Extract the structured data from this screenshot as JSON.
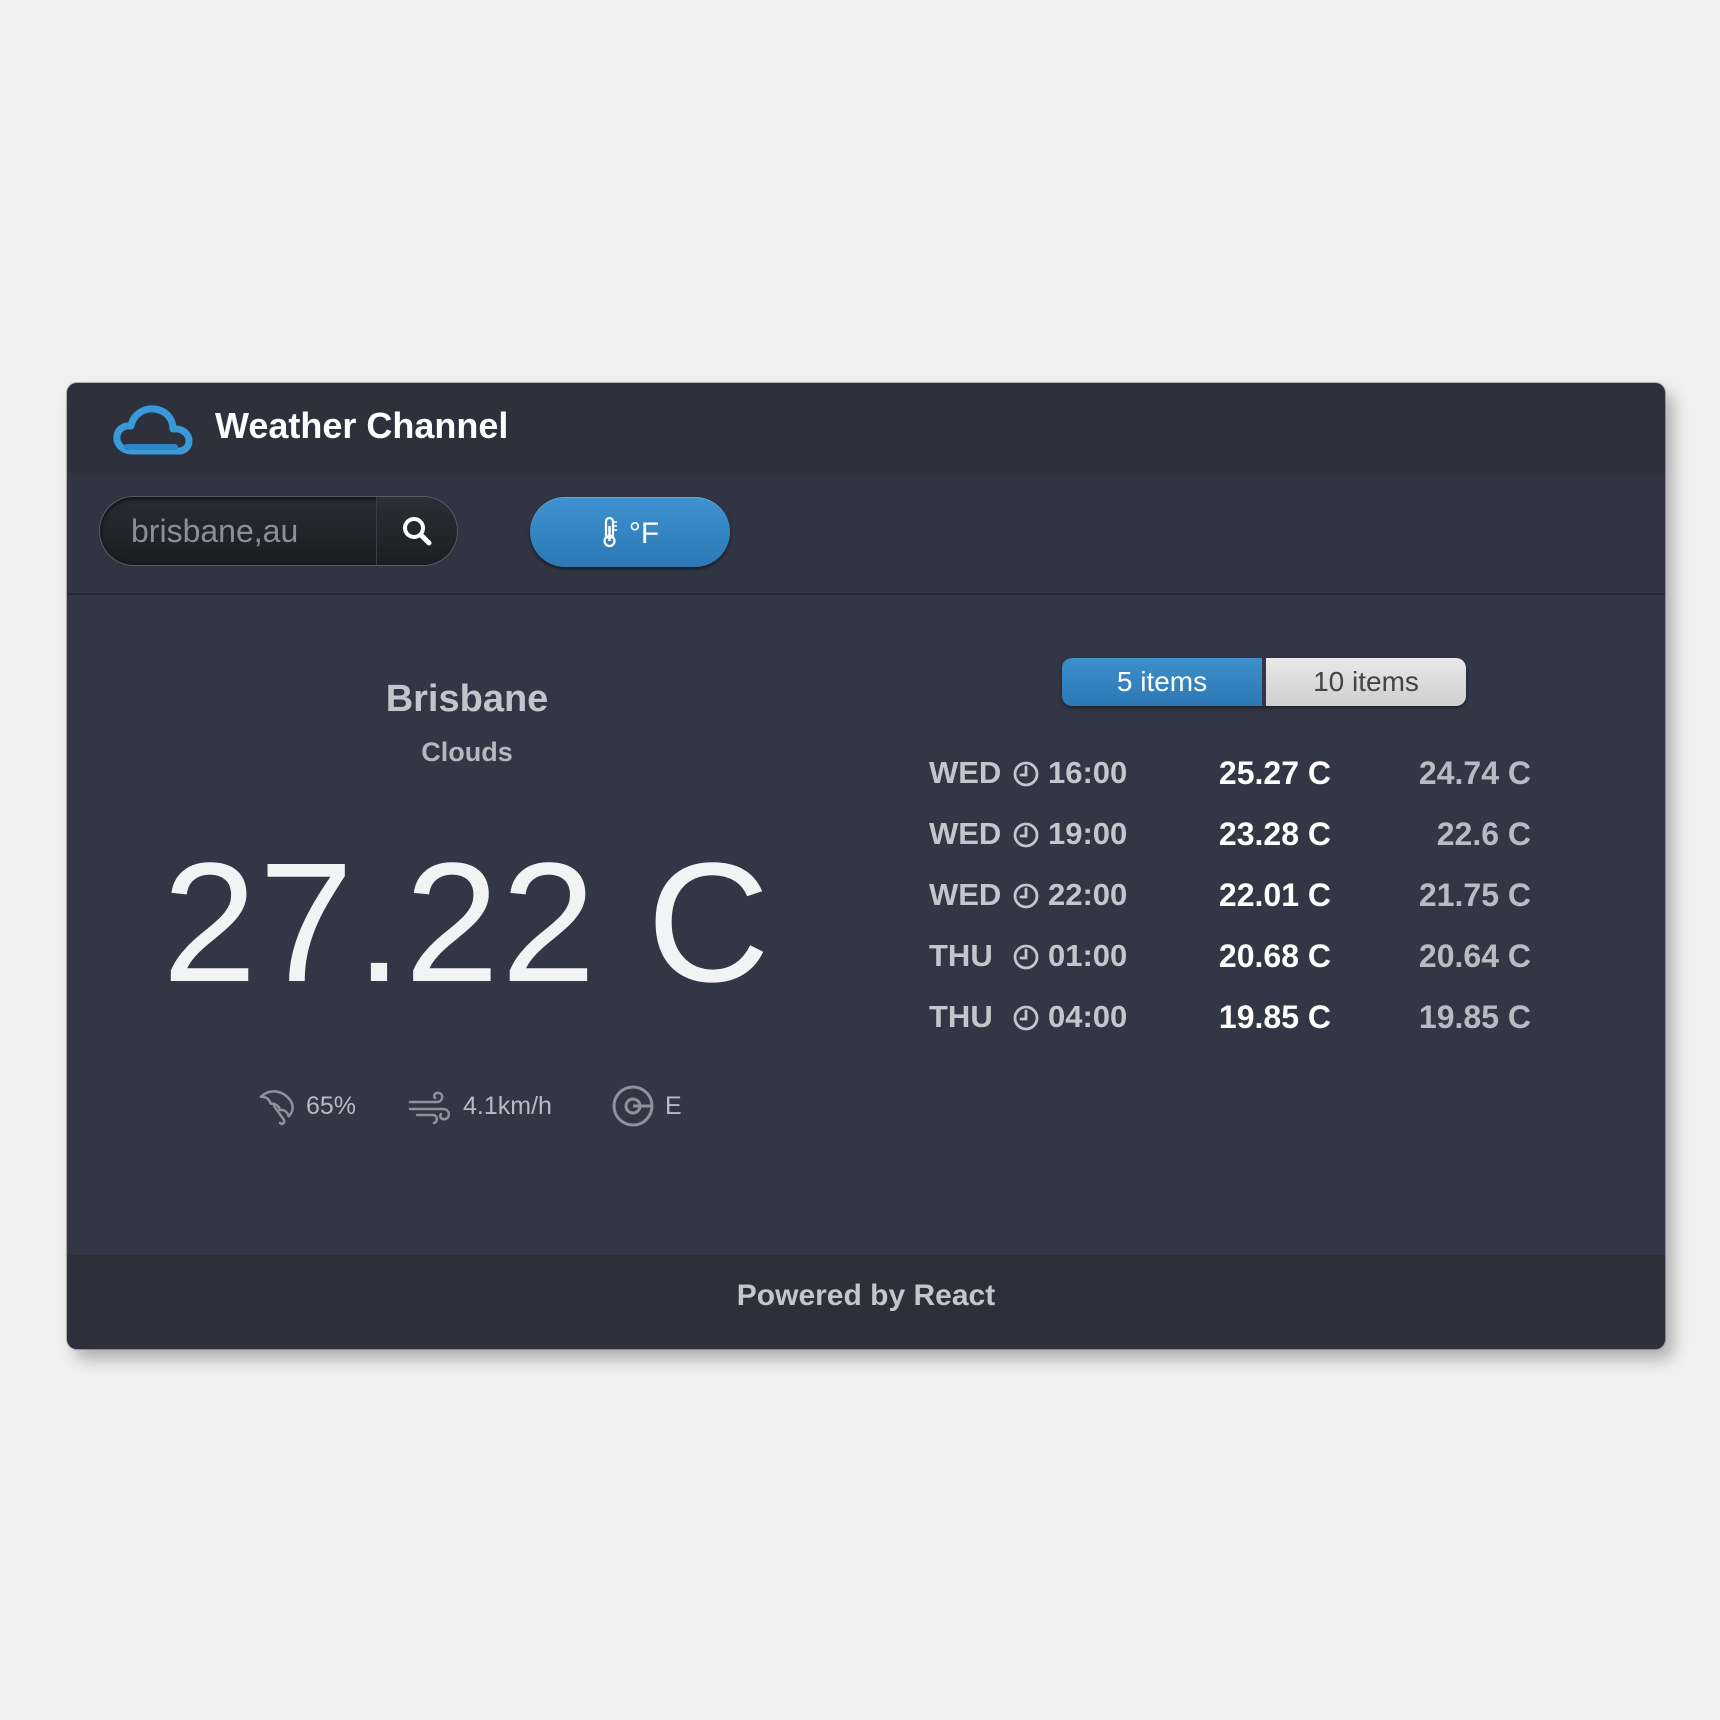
{
  "header": {
    "title": "Weather Channel",
    "logo_icon": "cloud-icon"
  },
  "toolbar": {
    "search_value": "brisbane,au",
    "search_icon": "search-icon",
    "unit_toggle_label": "°F",
    "unit_toggle_icon": "thermometer-icon"
  },
  "current": {
    "city": "Brisbane",
    "conditions": "Clouds",
    "temperature": "27.22 C",
    "humidity": "65%",
    "wind_speed": "4.1km/h",
    "wind_direction": "E",
    "icons": [
      "umbrella-icon",
      "wind-icon",
      "compass-icon"
    ]
  },
  "forecast_toggle": {
    "option_5": "5 items",
    "option_10": "10 items",
    "selected": "5 items"
  },
  "forecast": [
    {
      "day": "WED",
      "time": "16:00",
      "high": "25.27 C",
      "low": "24.74 C"
    },
    {
      "day": "WED",
      "time": "19:00",
      "high": "23.28 C",
      "low": "22.6 C"
    },
    {
      "day": "WED",
      "time": "22:00",
      "high": "22.01 C",
      "low": "21.75 C"
    },
    {
      "day": "THU",
      "time": "01:00",
      "high": "20.68 C",
      "low": "20.64 C"
    },
    {
      "day": "THU",
      "time": "04:00",
      "high": "19.85 C",
      "low": "19.85 C"
    }
  ],
  "footer": {
    "text": "Powered by React"
  },
  "colors": {
    "accent": "#2f80c0",
    "card_background": "#333644",
    "page_background": "#f0f0f0"
  }
}
